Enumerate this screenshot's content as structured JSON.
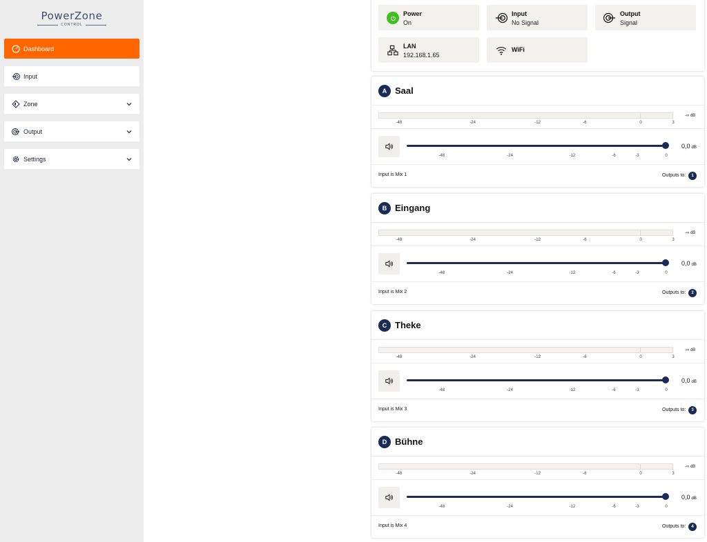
{
  "logo": {
    "title": "PowerZone",
    "subtitle": "CONTROL"
  },
  "sidebar": {
    "items": [
      {
        "label": "Dashboard",
        "icon": "gauge-icon",
        "active": true
      },
      {
        "label": "Input",
        "icon": "input-icon"
      },
      {
        "label": "Zone",
        "icon": "zone-icon",
        "expandable": true
      },
      {
        "label": "Output",
        "icon": "output-icon",
        "expandable": true
      },
      {
        "label": "Settings",
        "icon": "gear-icon",
        "expandable": true
      }
    ]
  },
  "status": {
    "power": {
      "label": "Power",
      "value": "On",
      "color": "#3fbf1f"
    },
    "input": {
      "label": "Input",
      "value": "No Signal"
    },
    "output": {
      "label": "Output",
      "value": "Signal"
    },
    "lan": {
      "label": "LAN",
      "value": "192.168.1.65"
    },
    "wifi": {
      "label": "WiFi"
    }
  },
  "meter_scale": [
    "-48",
    "-24",
    "-12",
    "-6",
    "0",
    "3"
  ],
  "volume_scale": [
    "-48",
    "-24",
    "-12",
    "-6",
    "-3",
    "0"
  ],
  "zones": [
    {
      "letter": "A",
      "name": "Saal",
      "meter_db": "-∞",
      "db_unit": "dB",
      "volume": "0,0",
      "volume_unit": "dB",
      "volume_level": 1.0,
      "input_text": "Input is Mix 1",
      "outputs_label": "Outputs to:",
      "output": "1"
    },
    {
      "letter": "B",
      "name": "Eingang",
      "meter_db": "-∞",
      "db_unit": "dB",
      "volume": "0,0",
      "volume_unit": "dB",
      "volume_level": 1.0,
      "input_text": "Input is Mix 2",
      "outputs_label": "Outputs to:",
      "output": "2"
    },
    {
      "letter": "C",
      "name": "Theke",
      "meter_db": "-∞",
      "db_unit": "dB",
      "volume": "0,0",
      "volume_unit": "dB",
      "volume_level": 1.0,
      "input_text": "Input is Mix 3",
      "outputs_label": "Outputs to:",
      "output": "3"
    },
    {
      "letter": "D",
      "name": "Bühne",
      "meter_db": "-∞",
      "db_unit": "dB",
      "volume": "0,0",
      "volume_unit": "dB",
      "volume_level": 1.0,
      "input_text": "Input is Mix 4",
      "outputs_label": "Outputs to:",
      "output": "4"
    }
  ],
  "colors": {
    "accent": "#ff6600",
    "navy": "#1c2b55",
    "power_on": "#3fbf1f"
  }
}
